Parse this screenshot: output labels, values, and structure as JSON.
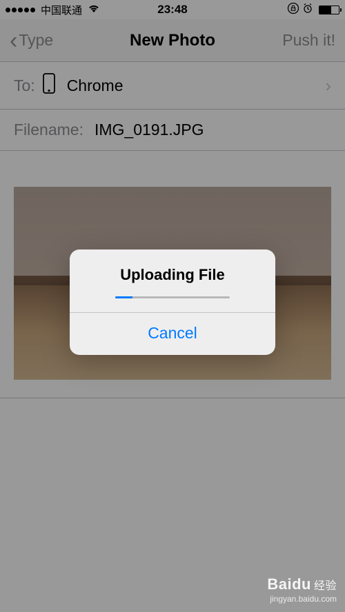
{
  "status_bar": {
    "carrier": "中国联通",
    "time": "23:48"
  },
  "nav": {
    "back_label": "Type",
    "title": "New Photo",
    "action_label": "Push it!"
  },
  "to_row": {
    "label": "To:",
    "value": "Chrome"
  },
  "filename_row": {
    "label": "Filename:",
    "value": "IMG_0191.JPG"
  },
  "modal": {
    "title": "Uploading File",
    "cancel_label": "Cancel",
    "progress_percent": 15
  },
  "watermark": {
    "brand": "Baidu",
    "brand_sub": "经验",
    "url": "jingyan.baidu.com"
  }
}
